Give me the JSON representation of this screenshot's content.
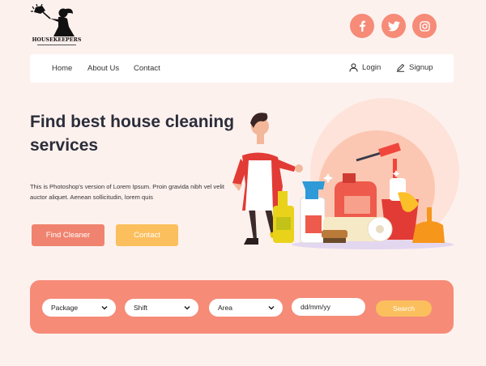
{
  "brand": {
    "name": "HOUSEKEEPERS"
  },
  "social": {
    "facebook": "facebook-icon",
    "twitter": "twitter-icon",
    "instagram": "instagram-icon",
    "accent": "#f68b78"
  },
  "nav": {
    "links": [
      "Home",
      "About Us",
      "Contact"
    ],
    "login": "Login",
    "signup": "Signup"
  },
  "hero": {
    "title": "Find best house cleaning services",
    "description": "This is Photoshop's version of Lorem Ipsum.  Proin gravida nibh vel velit auctor aliquet. Aenean sollicitudin, lorem quis",
    "primary_button": "Find Cleaner",
    "secondary_button": "Contact"
  },
  "search": {
    "package": "Package",
    "shift": "Shift",
    "area": "Area",
    "date_placeholder": "dd/mm/yy",
    "button": "Search"
  },
  "colors": {
    "coral": "#f68b78",
    "yellow": "#fbbf5d",
    "background": "#fdf1ee"
  }
}
